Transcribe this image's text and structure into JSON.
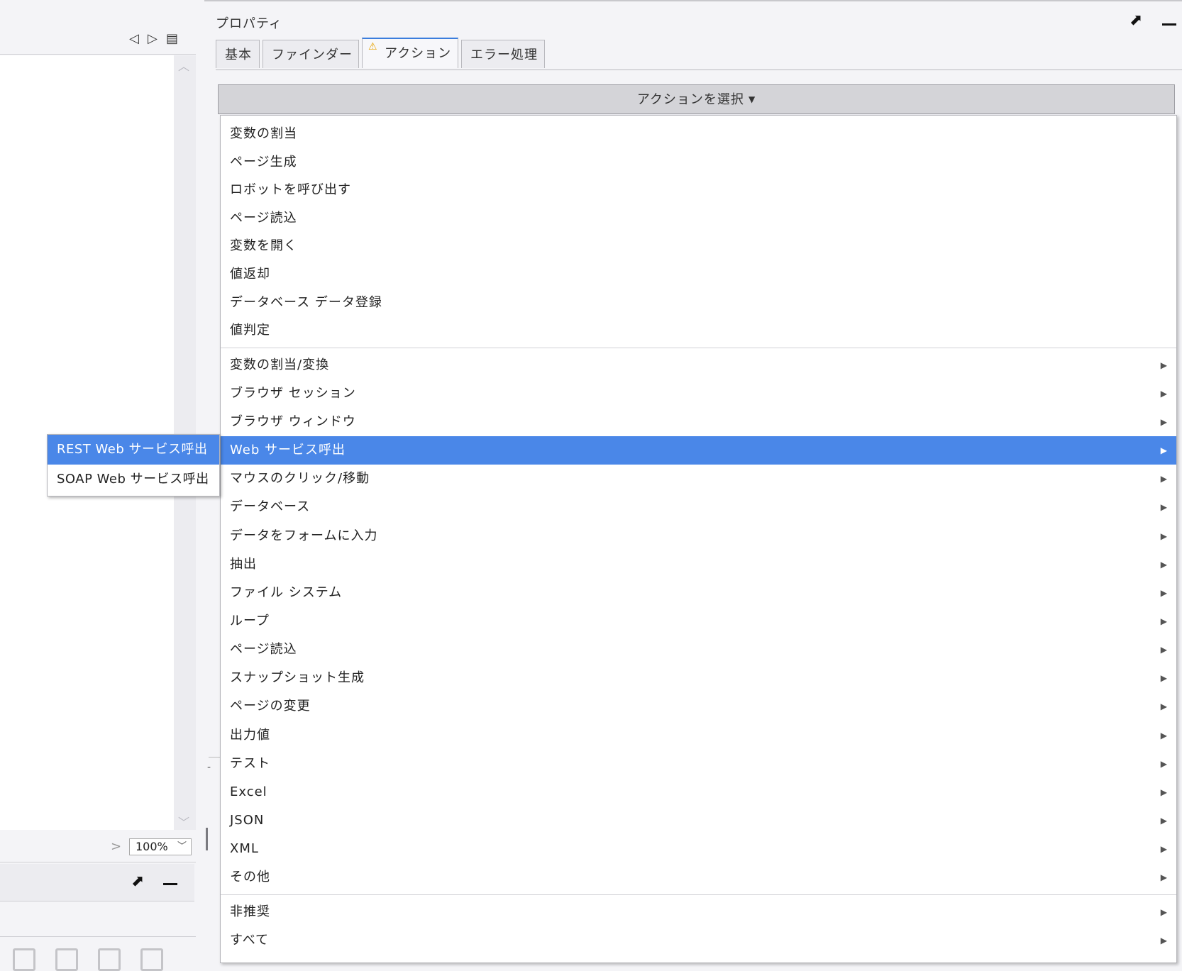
{
  "left_pane": {
    "zoom_value": "100%"
  },
  "panel": {
    "title": "プロパティ",
    "tabs": [
      {
        "label": "基本"
      },
      {
        "label": "ファインダー"
      },
      {
        "label": "アクション"
      },
      {
        "label": "エラー処理"
      }
    ],
    "action_select_label": "アクションを選択"
  },
  "menu": {
    "group1": [
      "変数の割当",
      "ページ生成",
      "ロボットを呼び出す",
      "ページ読込",
      "変数を開く",
      "値返却",
      "データベース データ登録",
      "値判定"
    ],
    "group2": [
      "変数の割当/変換",
      "ブラウザ セッション",
      "ブラウザ ウィンドウ",
      "Web サービス呼出",
      "マウスのクリック/移動",
      "データベース",
      "データをフォームに入力",
      "抽出",
      "ファイル システム",
      "ループ",
      "ページ読込",
      "スナップショット生成",
      "ページの変更",
      "出力値",
      "テスト",
      "Excel",
      "JSON",
      "XML",
      "その他"
    ],
    "group3": [
      "非推奨",
      "すべて"
    ],
    "selected": "Web サービス呼出"
  },
  "submenu": {
    "items": [
      "REST Web サービス呼出",
      "SOAP Web サービス呼出"
    ],
    "selected": "REST Web サービス呼出"
  },
  "colors": {
    "highlight": "#4a87e8",
    "warning": "#e8a400"
  },
  "icons": {
    "tab_warning": "warning-triangle-icon"
  }
}
